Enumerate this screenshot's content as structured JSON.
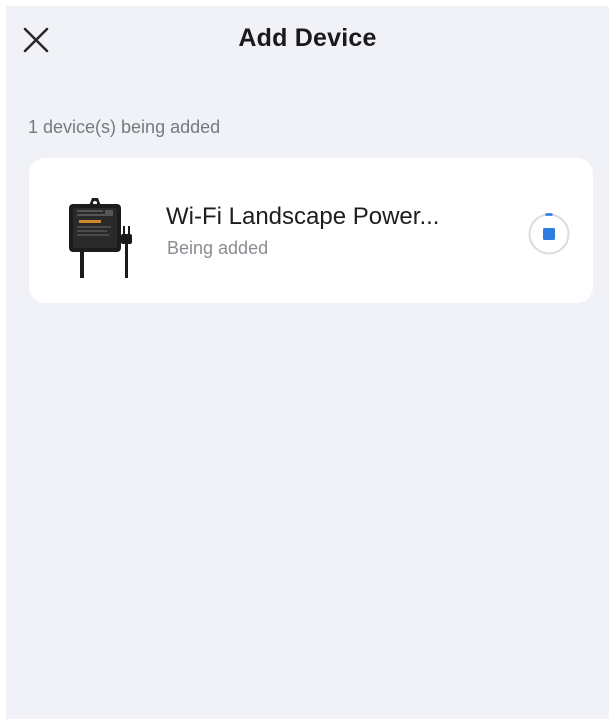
{
  "header": {
    "title": "Add Device",
    "close_icon": "close-icon"
  },
  "section": {
    "label": "1 device(s) being added"
  },
  "device": {
    "name": "Wi-Fi Landscape Power...",
    "status": "Being added",
    "image_icon": "power-adapter-icon",
    "action_icon": "stop-icon",
    "progress": 0.05
  },
  "colors": {
    "background": "#f0f2f7",
    "card": "#ffffff",
    "accent": "#2f7de1",
    "title_text": "#1a1a1a",
    "secondary_text": "#8a8c92"
  }
}
